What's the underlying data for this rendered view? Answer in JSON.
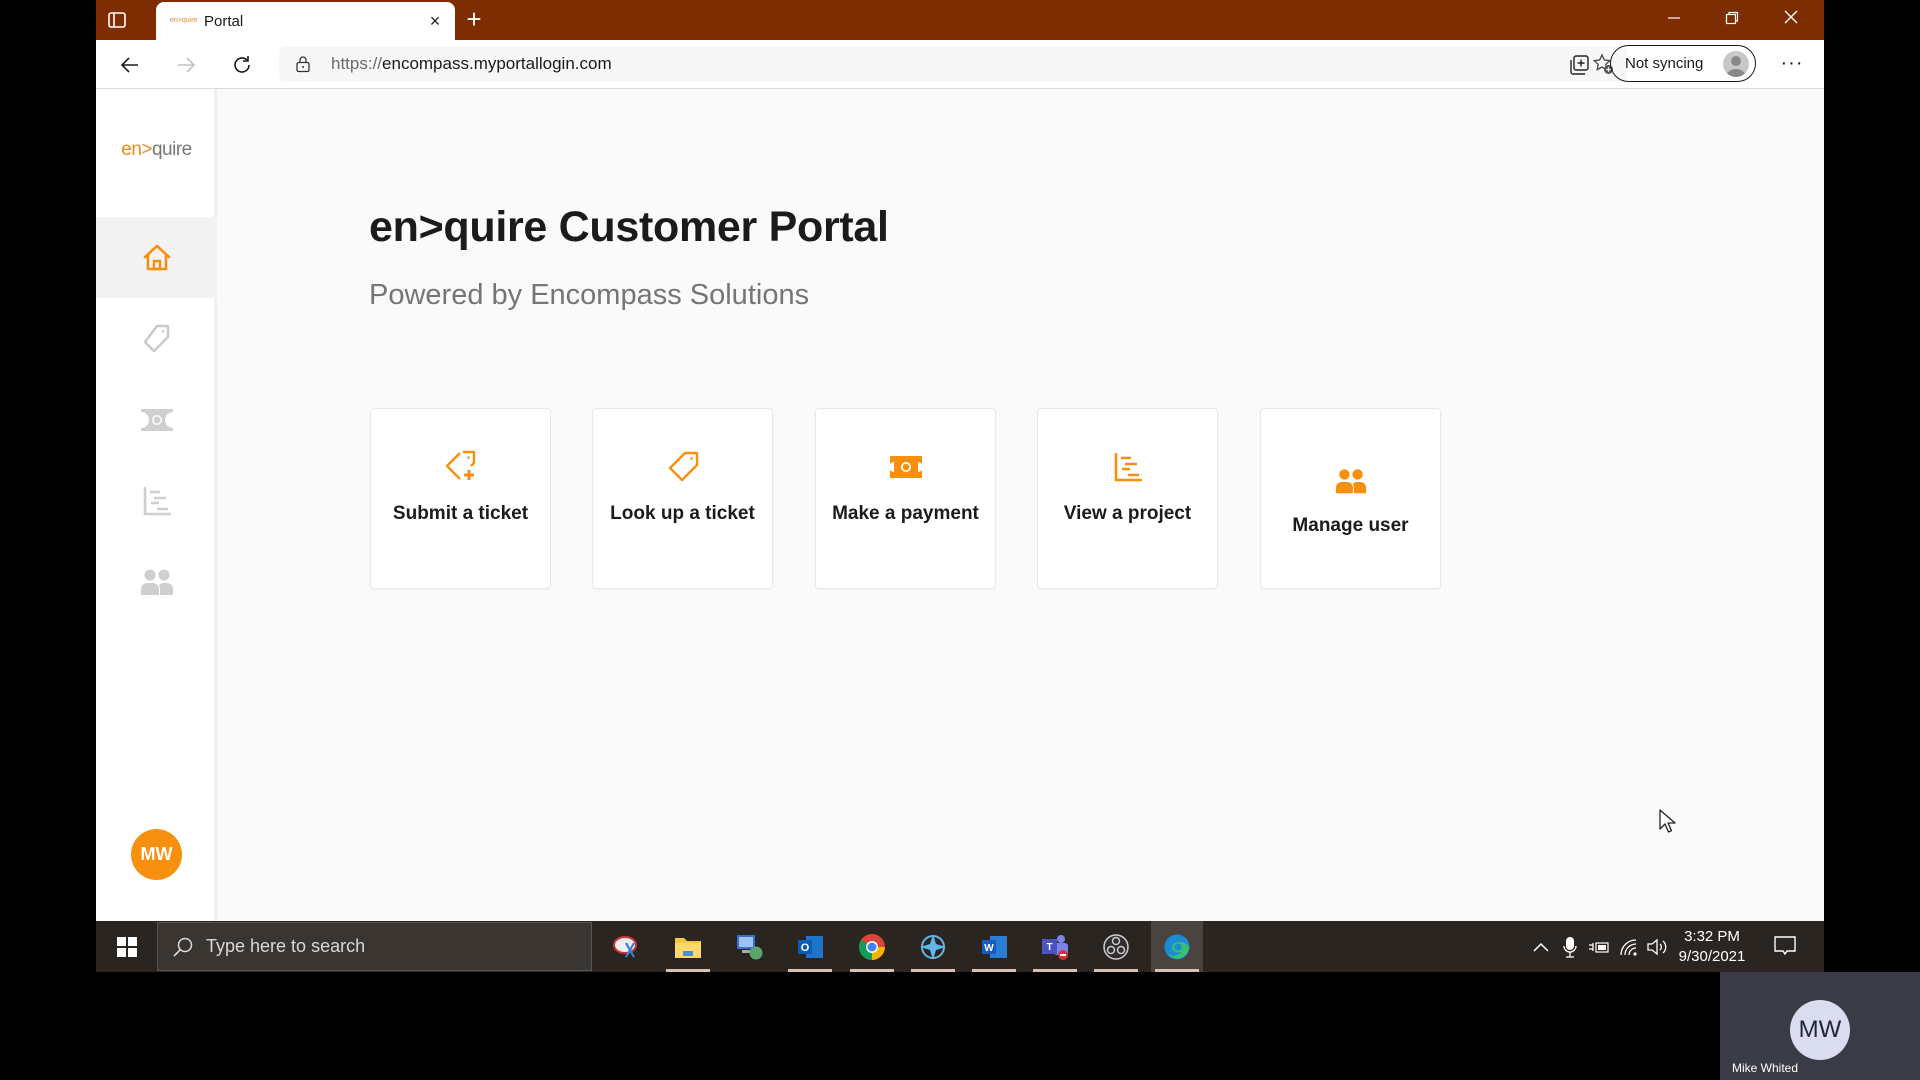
{
  "browser": {
    "tab_title": "Portal",
    "tab_favicon_text": "en>quire",
    "url_scheme": "https://",
    "url_host": "encompass.myportallogin.com",
    "sync_label": "Not syncing",
    "more_label": "···",
    "new_tab_label": "+",
    "close_tab_label": "×",
    "window_controls": {
      "minimize": "—",
      "restore": "❐",
      "close": "✕"
    }
  },
  "app": {
    "logo_prefix": "en>",
    "logo_suffix": "quire",
    "sidebar": {
      "items": [
        {
          "name": "home",
          "icon": "home-icon",
          "active": true
        },
        {
          "name": "tickets",
          "icon": "tag-icon",
          "active": false
        },
        {
          "name": "payments",
          "icon": "money-icon",
          "active": false
        },
        {
          "name": "projects",
          "icon": "project-chart-icon",
          "active": false
        },
        {
          "name": "users",
          "icon": "users-icon",
          "active": false
        }
      ],
      "user_initials": "MW"
    },
    "title": "en>quire Customer Portal",
    "subtitle": "Powered by Encompass Solutions",
    "accent_color": "#f7900f",
    "cards": [
      {
        "label": "Submit a ticket",
        "icon": "tag-plus-icon"
      },
      {
        "label": "Look up a ticket",
        "icon": "tag-icon"
      },
      {
        "label": "Make a payment",
        "icon": "money-icon"
      },
      {
        "label": "View a project",
        "icon": "project-chart-icon"
      },
      {
        "label": "Manage user",
        "icon": "users-icon"
      }
    ]
  },
  "taskbar": {
    "search_placeholder": "Type here to search",
    "apps": [
      "snipping-tool",
      "file-explorer",
      "remote-desktop",
      "outlook",
      "chrome",
      "vpn-client",
      "word",
      "teams",
      "obs-studio",
      "edge"
    ],
    "time": "3:32 PM",
    "date": "9/30/2021"
  },
  "meeting": {
    "initials": "MW",
    "name": "Mike Whited"
  }
}
